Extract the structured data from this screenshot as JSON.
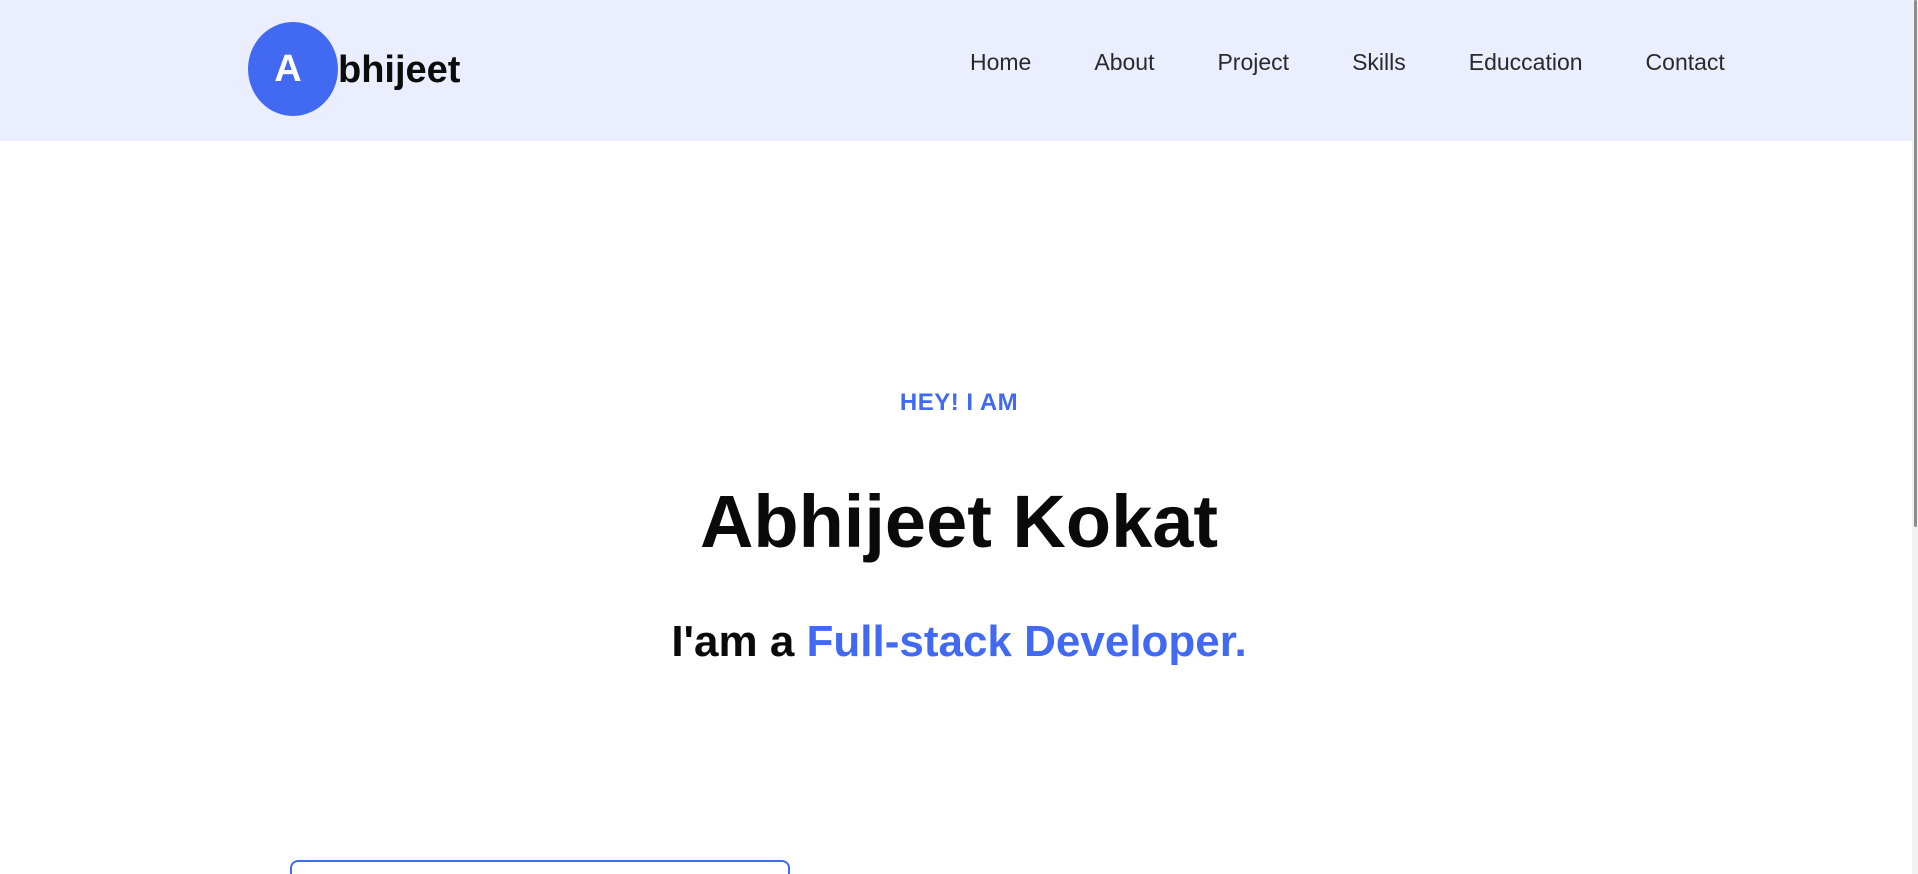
{
  "header": {
    "logo_initial": "A",
    "logo_text": "bhijeet",
    "nav": [
      {
        "label": "Home"
      },
      {
        "label": "About"
      },
      {
        "label": "Project"
      },
      {
        "label": "Skills"
      },
      {
        "label": "Educcation"
      },
      {
        "label": "Contact"
      }
    ]
  },
  "hero": {
    "eyebrow": "HEY! I AM",
    "name": "Abhijeet Kokat",
    "role_prefix": "I'am a ",
    "role_accent": "Full-stack Developer."
  },
  "colors": {
    "accent": "#4169f2",
    "header_bg": "#eaeefe",
    "text": "#0a0a0a"
  },
  "icons": {
    "logo": "circle-letter-logo"
  }
}
